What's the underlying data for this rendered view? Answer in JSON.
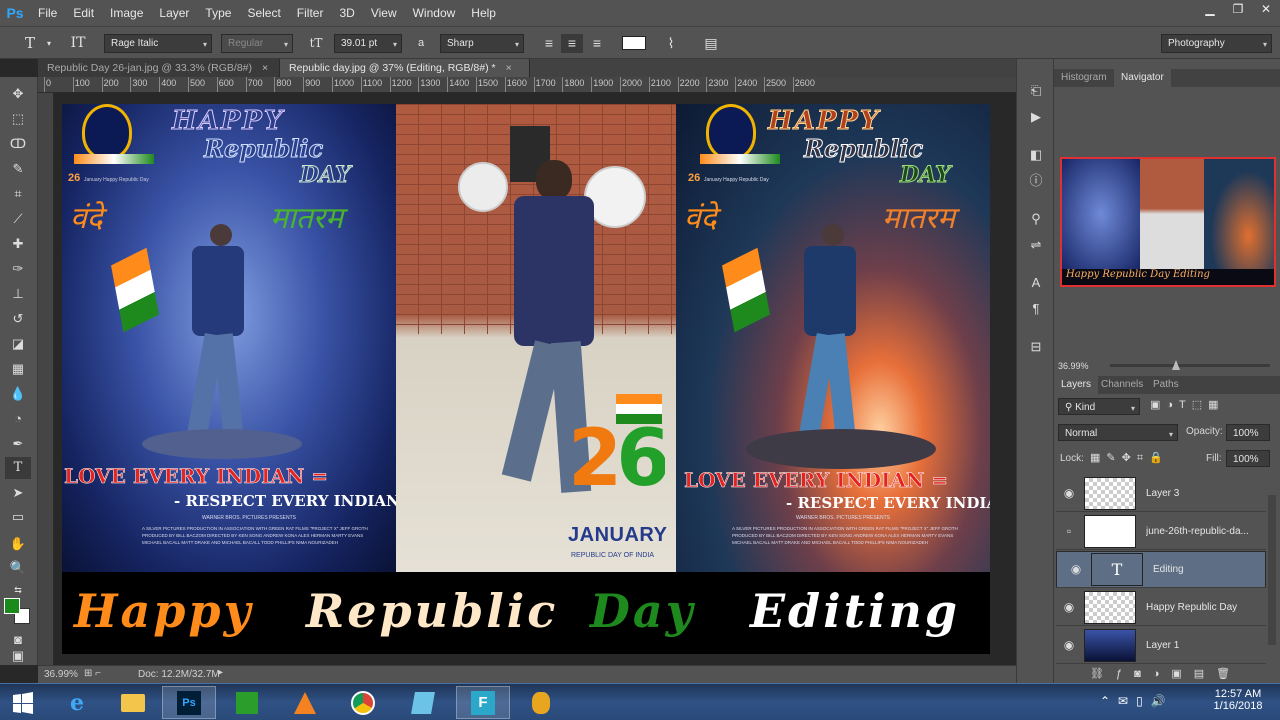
{
  "app": {
    "logo": "Ps"
  },
  "menu": [
    "File",
    "Edit",
    "Image",
    "Layer",
    "Type",
    "Select",
    "Filter",
    "3D",
    "View",
    "Window",
    "Help"
  ],
  "options": {
    "font_family": "Rage Italic",
    "font_style": "Regular",
    "font_size": "39.01 pt",
    "aa_label": "a",
    "antialias": "Sharp",
    "workspace": "Photography",
    "text_color": "#ffffff"
  },
  "tabs": [
    {
      "label": "Republic Day 26-jan.jpg @ 33.3% (RGB/8#)",
      "close": "×",
      "active": false
    },
    {
      "label": "Republic day.jpg @ 37% (Editing, RGB/8#) *",
      "close": "×",
      "active": true
    }
  ],
  "ruler": [
    "0",
    "100",
    "200",
    "300",
    "400",
    "500",
    "600",
    "700",
    "800",
    "900",
    "1000",
    "1100",
    "1200",
    "1300",
    "1400",
    "1500",
    "1600",
    "1700",
    "1800",
    "1900",
    "2000",
    "2100",
    "2200",
    "2300",
    "2400",
    "2500",
    "2600"
  ],
  "artboard": {
    "poster1": {
      "happy": "HAPPY",
      "republic": "Republic",
      "day": "DAY",
      "badge_date": "26",
      "badge_text": "January Happy Republic Day",
      "vande": "वंदे",
      "mataram": "मातरम",
      "line1": "LOVE EVERY INDIAN =",
      "line2": "- RESPECT EVERY INDIAN ....",
      "credits_top": "WARNER BROS. PICTURES PRESENTS",
      "credits": "A SILVER PICTURES PRODUCTION IN ASSOCIATION WITH GREEN RAT FILMS \"PROJECT X\" JEFF GROTH",
      "credits2": "PRODUCED BY BILL BACZOM  DIRECTED BY KEN SONG  ANDREW KONA  ALEX HERMAN  MARTY EVANS",
      "credits3": "MICHAEL BACALL  MATT DRAKE AND MICHAEL BACALL  TODD PHILLIPS  NIMA NOURIZADEH"
    },
    "poster2": {
      "num": "26",
      "month": "JANUARY",
      "sub": "REPUBLIC DAY OF INDIA"
    },
    "poster3": {
      "happy": "HAPPY",
      "republic": "Republic",
      "day": "DAY",
      "badge_date": "26",
      "badge_text": "January Happy Republic Day",
      "vande": "वंदे",
      "mataram": "मातरम",
      "line1": "LOVE EVERY INDIAN =",
      "line2": "- RESPECT EVERY INDIAN",
      "credits_top": "WARNER BROS. PICTURES PRESENTS",
      "credits": "A SILVER PICTURES PRODUCTION IN ASSOCIATION WITH GREEN RAT FILMS \"PROJECT X\" JEFF GROTH",
      "credits2": "PRODUCED BY BILL BACZOM  DIRECTED BY KEN SONG  ANDREW KONA  ALEX HERMAN  MARTY EVANS",
      "credits3": "MICHAEL BACALL  MATT DRAKE AND MICHAEL BACALL  TODD PHILLIPS  NIMA NOURIZADEH"
    },
    "banner": [
      {
        "word": "Happy",
        "color": "#ff8c1a"
      },
      {
        "word": "Republic",
        "color": "#ffe8c8"
      },
      {
        "word": "Day",
        "color": "#1e8a1e"
      },
      {
        "word": "Editing",
        "color": "#ffffff"
      }
    ]
  },
  "status": {
    "zoom": "36.99%",
    "doc": "Doc: 12.2M/32.7M"
  },
  "navigator": {
    "tabs": [
      "Histogram",
      "Navigator"
    ],
    "zoom": "36.99%",
    "preview_text": "Happy Republic Day Editing"
  },
  "layers_panel": {
    "tabs": [
      "Layers",
      "Channels",
      "Paths"
    ],
    "kind": "Kind",
    "blend": "Normal",
    "opacity_label": "Opacity:",
    "opacity": "100%",
    "lock_label": "Lock:",
    "fill_label": "Fill:",
    "fill": "100%",
    "type_glyph": "T",
    "layers": [
      {
        "name": "Layer 3",
        "visible": true,
        "selected": false
      },
      {
        "name": "june-26th-republic-da...",
        "visible": false,
        "selected": false
      },
      {
        "name": "Editing",
        "visible": true,
        "selected": true
      },
      {
        "name": "Happy Republic Day",
        "visible": true,
        "selected": false
      },
      {
        "name": "Layer 1",
        "visible": true,
        "selected": false
      }
    ]
  },
  "taskbar": {
    "time": "12:57 AM",
    "date": "1/16/2018",
    "apps": [
      "windows-start",
      "internet-explorer",
      "file-explorer",
      "photoshop",
      "store",
      "vlc",
      "chrome",
      "notepad",
      "app-f",
      "pineapple"
    ]
  },
  "colors": {
    "foreground": "#1a8a1a",
    "background": "#ffffff"
  }
}
